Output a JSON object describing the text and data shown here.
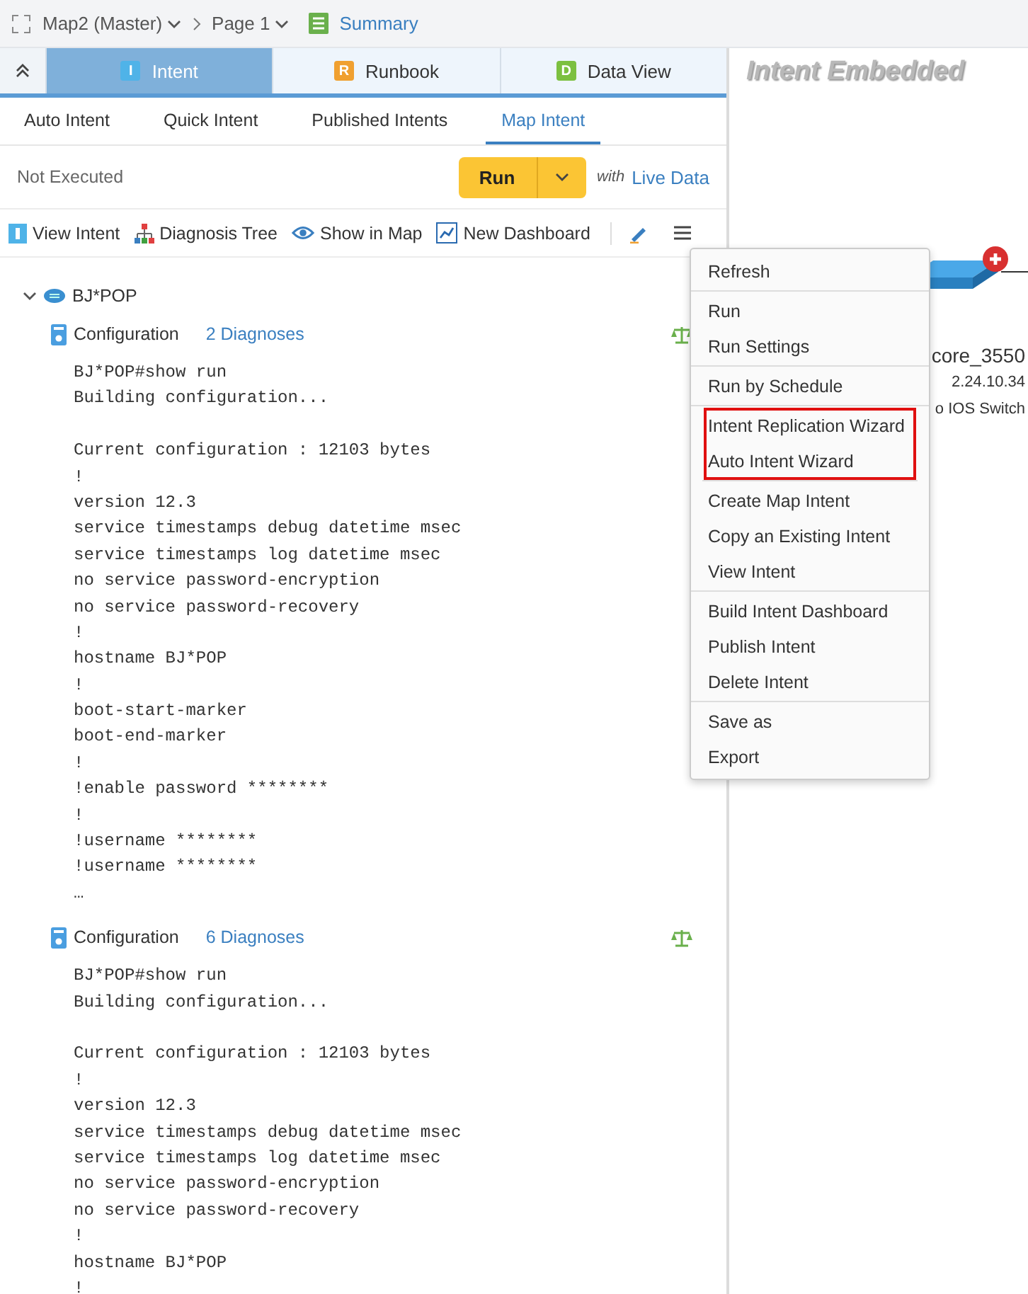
{
  "breadcrumb": {
    "map": "Map2 (Master)",
    "page": "Page 1",
    "summary": "Summary"
  },
  "tabs": [
    {
      "letter": "I",
      "label": "Intent",
      "color": "#4fb3e8",
      "selected": true
    },
    {
      "letter": "R",
      "label": "Runbook",
      "color": "#f0a030",
      "selected": false
    },
    {
      "letter": "D",
      "label": "Data View",
      "color": "#7cc040",
      "selected": false
    }
  ],
  "subtabs": [
    {
      "label": "Auto Intent",
      "selected": false
    },
    {
      "label": "Quick Intent",
      "selected": false
    },
    {
      "label": "Published Intents",
      "selected": false
    },
    {
      "label": "Map Intent",
      "selected": true
    }
  ],
  "run_bar": {
    "status": "Not Executed",
    "run_button": "Run",
    "with": "with",
    "live_data": "Live Data"
  },
  "toolbar": [
    {
      "kind": "intent",
      "label": "View Intent"
    },
    {
      "kind": "tree",
      "label": "Diagnosis Tree"
    },
    {
      "kind": "eye",
      "label": "Show in Map"
    },
    {
      "kind": "chart",
      "label": "New Dashboard"
    }
  ],
  "tree": {
    "device": "BJ*POP",
    "expanded": true,
    "sections": [
      {
        "title": "Configuration",
        "diagnoses": "2 Diagnoses",
        "blocks": [
          [
            "BJ*POP#show run",
            "Building configuration..."
          ],
          [
            "Current configuration : 12103 bytes",
            "!",
            "version 12.3",
            "service timestamps debug datetime msec",
            "service timestamps log datetime msec",
            "no service password-encryption",
            "no service password-recovery",
            "!",
            "hostname BJ*POP",
            "!",
            "boot-start-marker",
            "boot-end-marker",
            "!",
            "!enable password ********",
            "!",
            "!username ********",
            "!username ********",
            "…"
          ]
        ]
      },
      {
        "title": "Configuration",
        "diagnoses": "6 Diagnoses",
        "blocks": [
          [
            "BJ*POP#show run",
            "Building configuration..."
          ],
          [
            "Current configuration : 12103 bytes",
            "!",
            "version 12.3",
            "service timestamps debug datetime msec",
            "service timestamps log datetime msec",
            "no service password-encryption",
            "no service password-recovery",
            "!",
            "hostname BJ*POP",
            "!"
          ]
        ]
      }
    ]
  },
  "canvas": {
    "watermark": "Intent Embedded",
    "device_name": "core_3550",
    "device_ip": "2.24.10.34",
    "device_type": "o IOS Switch"
  },
  "menu": {
    "groups": [
      {
        "highlighted": false,
        "items": [
          "Refresh"
        ]
      },
      {
        "highlighted": false,
        "items": [
          "Run",
          "Run Settings"
        ]
      },
      {
        "highlighted": false,
        "items": [
          "Run by Schedule"
        ]
      },
      {
        "highlighted": true,
        "items": [
          "Intent Replication Wizard",
          "Auto Intent Wizard"
        ]
      },
      {
        "highlighted": false,
        "items": [
          "Create Map Intent",
          "Copy an Existing Intent",
          "View Intent"
        ]
      },
      {
        "highlighted": false,
        "items": [
          "Build Intent Dashboard",
          "Publish Intent",
          "Delete Intent"
        ]
      },
      {
        "highlighted": false,
        "items": [
          "Save as",
          "Export"
        ]
      }
    ]
  }
}
